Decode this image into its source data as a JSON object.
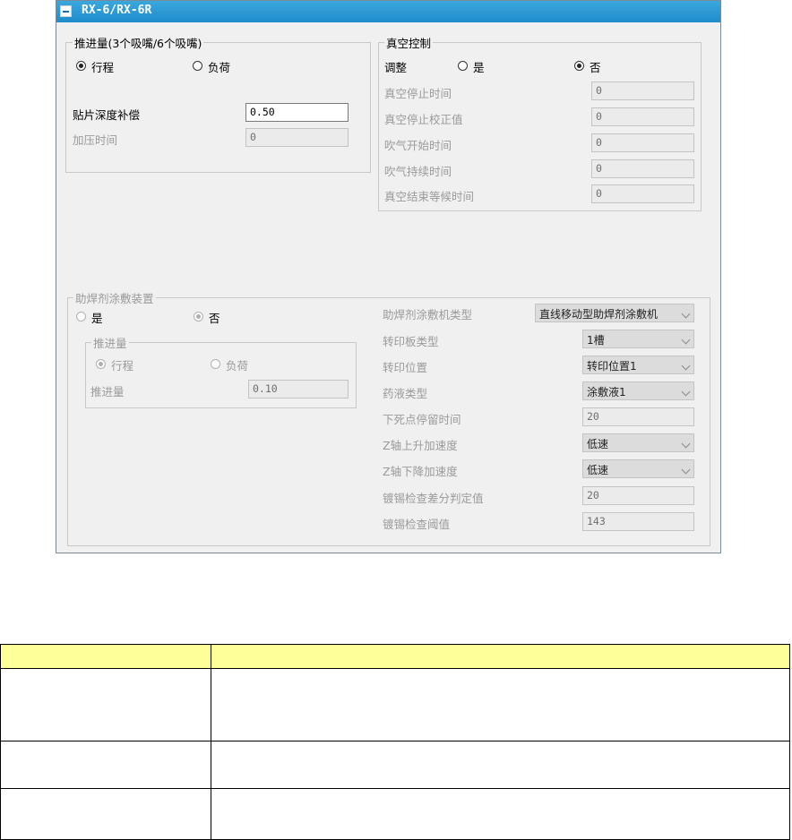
{
  "window": {
    "title": "RX-6/RX-6R"
  },
  "push_group": {
    "legend": "推进量(3个吸嘴/6个吸嘴)",
    "option_stroke": "行程",
    "option_load": "负荷",
    "depth_label": "贴片深度补偿",
    "depth_value": "0.50",
    "press_label": "加压时间",
    "press_value": "0"
  },
  "vacuum_group": {
    "legend": "真空控制",
    "adjust_label": "调整",
    "option_yes": "是",
    "option_no": "否",
    "rows": [
      {
        "label": "真空停止时间",
        "value": "0"
      },
      {
        "label": "真空停止校正值",
        "value": "0"
      },
      {
        "label": "吹气开始时间",
        "value": "0"
      },
      {
        "label": "吹气持续时间",
        "value": "0"
      },
      {
        "label": "真空结束等候时间",
        "value": "0"
      }
    ]
  },
  "flux_group": {
    "legend": "助焊剂涂敷装置",
    "option_yes": "是",
    "option_no": "否",
    "sub_legend": "推进量",
    "sub_option_stroke": "行程",
    "sub_option_load": "负荷",
    "sub_push_label": "推进量",
    "sub_push_value": "0.10",
    "settings": [
      {
        "label": "助焊剂涂敷机类型",
        "value": "直线移动型助焊剂涂敷机"
      },
      {
        "label": "转印板类型",
        "value": "1槽"
      },
      {
        "label": "转印位置",
        "value": "转印位置1"
      },
      {
        "label": "药液类型",
        "value": "涂敷液1"
      },
      {
        "label": "下死点停留时间",
        "value": "20"
      },
      {
        "label": "Z轴上升加速度",
        "value": "低速"
      },
      {
        "label": "Z轴下降加速度",
        "value": "低速"
      },
      {
        "label": "镀锡检查差分判定值",
        "value": "20"
      },
      {
        "label": "镀锡检查阈值",
        "value": "143"
      }
    ]
  },
  "description_table": {
    "header": [
      "",
      ""
    ],
    "rows": [
      [
        "",
        ""
      ],
      [
        "",
        ""
      ],
      [
        "",
        ""
      ]
    ]
  }
}
